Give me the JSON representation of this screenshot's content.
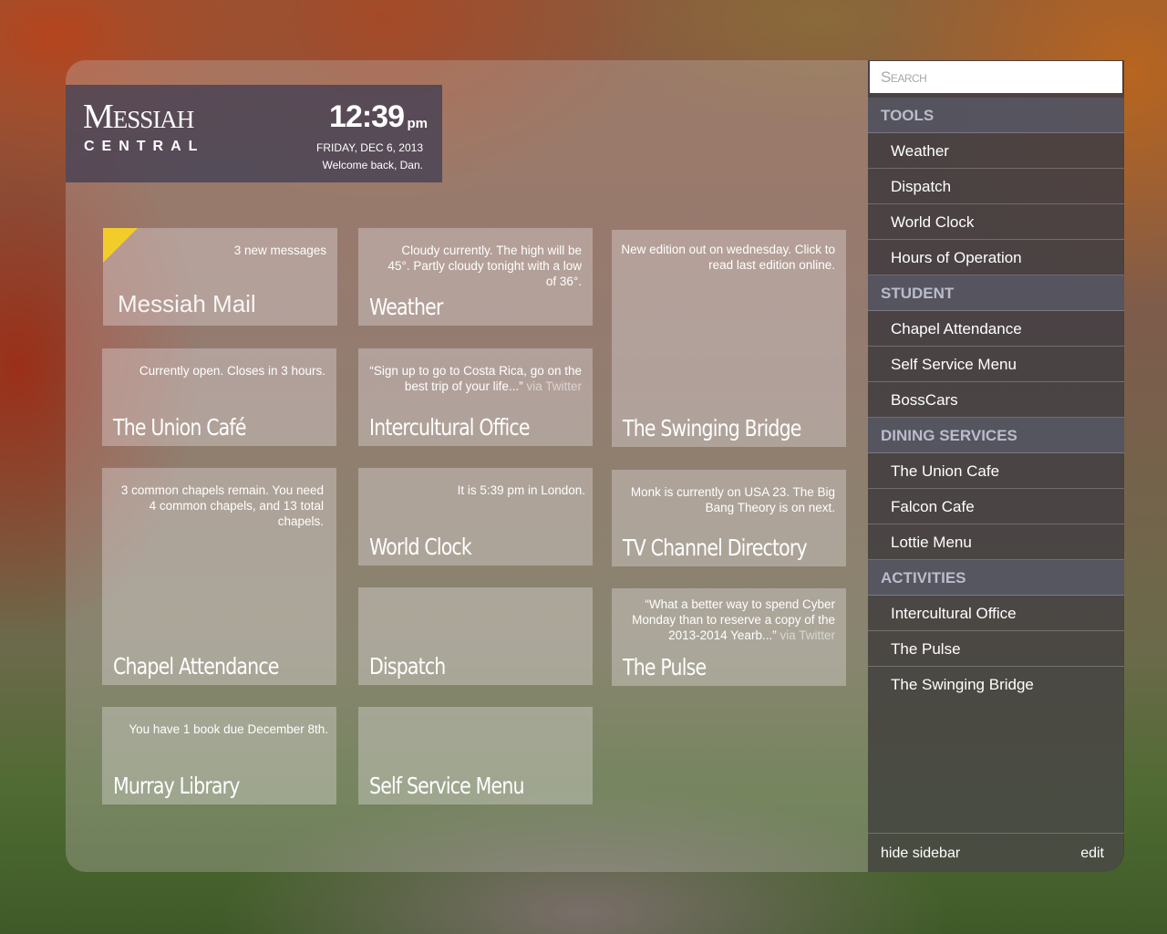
{
  "header": {
    "logo_main": "Messiah",
    "logo_sub": "CENTRAL",
    "time": "12:39",
    "ampm": "pm",
    "date": "FRIDAY, DEC 6, 2013",
    "welcome": "Welcome back, Dan."
  },
  "tiles": {
    "mail": {
      "note": "3 new messages",
      "title": "Messiah Mail"
    },
    "weather": {
      "note": "Cloudy currently. The high will be 45°. Partly cloudy tonight with a low of 36°.",
      "title": "Weather"
    },
    "swinging_bridge": {
      "note": "New edition out on wednesday. Click to read last edition online.",
      "title": "The Swinging Bridge"
    },
    "union_cafe": {
      "note": "Currently open. Closes in 3 hours.",
      "title": "The Union Café"
    },
    "intercultural": {
      "note": "“Sign up to go to Costa Rica, go on the best trip of your life...”",
      "via": "via Twitter",
      "title": "Intercultural Office"
    },
    "chapel": {
      "note": "3 common chapels remain. You need 4 common chapels, and 13 total chapels.",
      "title": "Chapel Attendance"
    },
    "world_clock": {
      "note": "It is 5:39 pm in London.",
      "title": "World Clock"
    },
    "tv": {
      "note": "Monk is currently on USA 23. The Big Bang Theory is on next.",
      "title": "TV Channel Directory"
    },
    "dispatch": {
      "title": "Dispatch"
    },
    "pulse": {
      "note": "“What a better way to spend Cyber Monday than to reserve a copy of the 2013-2014 Yearb...”",
      "via": "via Twitter",
      "title": "The Pulse"
    },
    "library": {
      "note": "You have 1 book due December 8th.",
      "title": "Murray Library"
    },
    "self_service": {
      "title": "Self Service Menu"
    }
  },
  "sidebar": {
    "search_placeholder": "Search",
    "sections": [
      {
        "header": "TOOLS",
        "items": [
          "Weather",
          "Dispatch",
          "World Clock",
          "Hours of Operation"
        ]
      },
      {
        "header": "STUDENT",
        "items": [
          "Chapel Attendance",
          "Self Service Menu",
          "BossCars"
        ]
      },
      {
        "header": "DINING SERVICES",
        "items": [
          "The Union Cafe",
          "Falcon Cafe",
          "Lottie Menu"
        ]
      },
      {
        "header": "ACTIVITIES",
        "items": [
          "Intercultural Office",
          "The Pulse",
          "The Swinging Bridge"
        ]
      }
    ],
    "hide_label": "hide sidebar",
    "edit_label": "edit"
  },
  "colors": {
    "header_bg": "#3a3a52",
    "flag": "#f2cd2a",
    "section_header_text": "#b9bccb"
  }
}
